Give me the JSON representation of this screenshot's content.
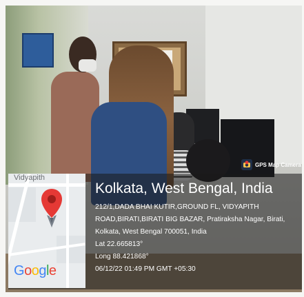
{
  "overlay": {
    "title": "Kolkata, West Bengal, India",
    "address": "212/1,DADA BHAI KUTIR,GROUND FL, VIDYAPITH ROAD,BIRATI,BIRATI BIG BAZAR, Pratiraksha Nagar, Birati, Kolkata, West Bengal 700051, India",
    "lat": "Lat 22.665813°",
    "long": "Long 88.421868°",
    "timestamp": "06/12/22 01:49 PM GMT +05:30"
  },
  "map": {
    "top_label": "Vidyapith",
    "logo": {
      "G": "G",
      "o1": "o",
      "o2": "o",
      "g": "g",
      "l": "l",
      "e": "e"
    }
  },
  "brand": {
    "label": "GPS Map Camera",
    "icon": "camera-pin-icon"
  },
  "colors": {
    "pin": "#e53935",
    "overlay": "rgba(25,25,25,0.55)",
    "text": "#ffffff"
  }
}
